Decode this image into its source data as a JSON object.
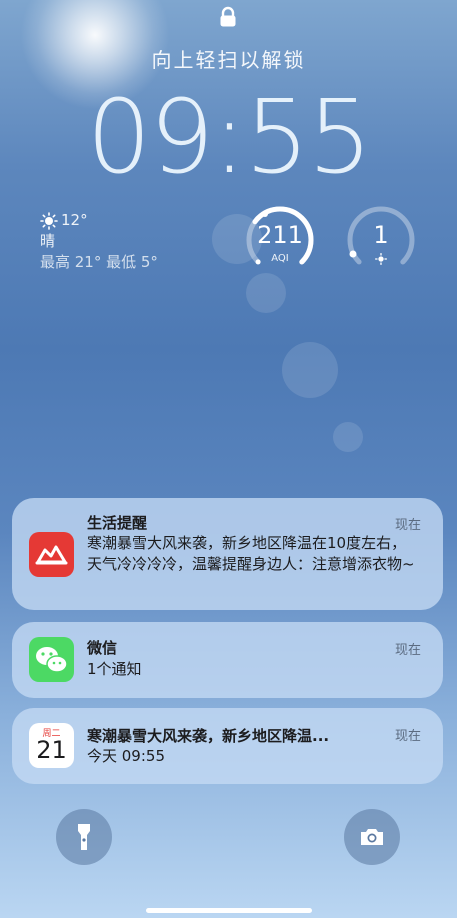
{
  "lock_screen": {
    "unlock_hint": "向上轻扫以解锁",
    "time": "09:55"
  },
  "weather": {
    "temperature": "12°",
    "condition": "晴",
    "range": "最高 21° 最低 5°"
  },
  "aqi": {
    "value": "211",
    "label": "AQI",
    "level": 0.7
  },
  "uv": {
    "value": "1",
    "icon": "sun-icon",
    "level": 0.1
  },
  "notifications": [
    {
      "app": "生活提醒",
      "time": "现在",
      "body": "寒潮暴雪大风来袭，新乡地区降温在10度左右，天气冷冷冷冷，温馨提醒身边人：注意增添衣物~",
      "icon": "red-cloud-icon",
      "icon_color": "#e53935"
    },
    {
      "app": "微信",
      "time": "现在",
      "body": "1个通知",
      "icon": "wechat-icon",
      "icon_color": "#4cd964"
    },
    {
      "app": "寒潮暴雪大风来袭，新乡地区降温...",
      "time": "现在",
      "body": "今天 09:55",
      "icon": "calendar-icon",
      "calendar_weekday": "周二",
      "calendar_day": "21"
    }
  ],
  "colors": {
    "accent_red": "#e53935",
    "wechat_green": "#4cd964"
  }
}
